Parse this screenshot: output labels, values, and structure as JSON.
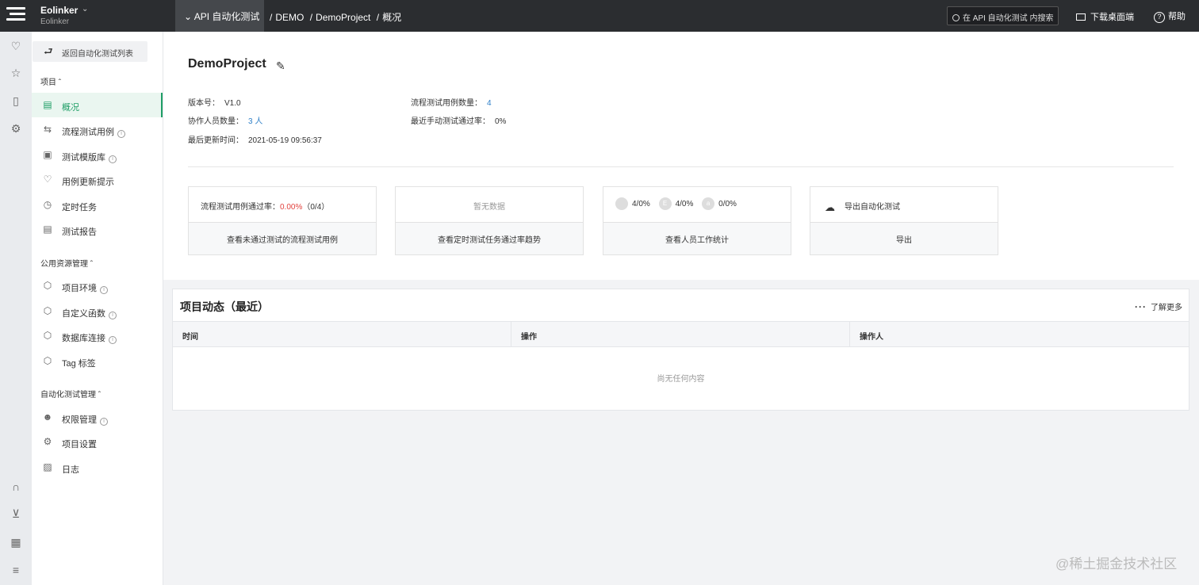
{
  "topbar": {
    "brand": "Eolinker",
    "brand_sub": "Eolinker",
    "module": "API 自动化测试",
    "breadcrumb": [
      "DEMO",
      "DemoProject",
      "概况"
    ],
    "search_placeholder": "在 API 自动化测试 内搜索",
    "download": "下载桌面端",
    "help": "帮助"
  },
  "sidebar": {
    "back": "返回自动化测试列表",
    "groups": [
      {
        "title": "项目",
        "items": [
          {
            "label": "概况",
            "icon": "overview-icon",
            "info": false,
            "active": true
          },
          {
            "label": "流程测试用例",
            "icon": "flow-case-icon",
            "info": true
          },
          {
            "label": "测试模版库",
            "icon": "template-icon",
            "info": true
          },
          {
            "label": "用例更新提示",
            "icon": "bell-icon",
            "info": false
          },
          {
            "label": "定时任务",
            "icon": "clock-icon",
            "info": false
          },
          {
            "label": "测试报告",
            "icon": "report-icon",
            "info": false
          }
        ]
      },
      {
        "title": "公用资源管理",
        "items": [
          {
            "label": "项目环境",
            "icon": "cube-icon",
            "info": true
          },
          {
            "label": "自定义函数",
            "icon": "cube-icon",
            "info": true
          },
          {
            "label": "数据库连接",
            "icon": "cube-icon",
            "info": true
          },
          {
            "label": "Tag 标签",
            "icon": "cube-icon",
            "info": false
          }
        ]
      },
      {
        "title": "自动化测试管理",
        "items": [
          {
            "label": "权限管理",
            "icon": "user-icon",
            "info": true
          },
          {
            "label": "项目设置",
            "icon": "gear-icon",
            "info": false
          },
          {
            "label": "日志",
            "icon": "clipboard-icon",
            "info": false
          }
        ]
      }
    ]
  },
  "overview": {
    "title": "DemoProject",
    "version_label": "版本号：",
    "version": "V1.0",
    "collab_label": "协作人员数量：",
    "collab": "3 人",
    "updated_label": "最后更新时间：",
    "updated": "2021-05-19 09:56:37",
    "flow_count_label": "流程测试用例数量：",
    "flow_count": "4",
    "manual_pass_label": "最近手动测试通过率：",
    "manual_pass": "0%"
  },
  "cards": {
    "c1": {
      "prefix": "流程测试用例通过率：",
      "rate": "0.00%",
      "detail": "（0/4）",
      "action": "查看未通过测试的流程测试用例"
    },
    "c2": {
      "top": "暂无数据",
      "action": "查看定时测试任务通过率趋势"
    },
    "c3": {
      "stats": [
        {
          "badge": "",
          "value": "4/0%"
        },
        {
          "badge": "E",
          "value": "4/0%"
        },
        {
          "badge": "a",
          "value": "0/0%"
        }
      ],
      "action": "查看人员工作统计"
    },
    "c4": {
      "top": "导出自动化测试",
      "action": "导出"
    }
  },
  "activity": {
    "title": "项目动态（最近）",
    "more": "了解更多",
    "columns": [
      "时间",
      "操作",
      "操作人"
    ],
    "empty": "尚无任何内容"
  },
  "watermark": "@稀土掘金技术社区"
}
